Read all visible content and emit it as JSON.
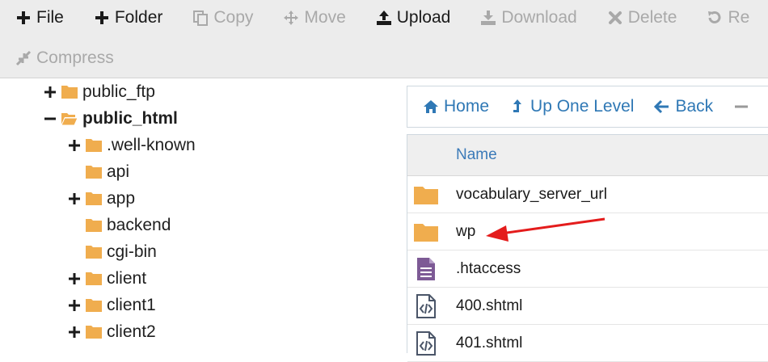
{
  "toolbar": {
    "row1": [
      {
        "label": "File",
        "icon": "plus-icon",
        "enabled": true
      },
      {
        "label": "Folder",
        "icon": "plus-icon",
        "enabled": true
      },
      {
        "label": "Copy",
        "icon": "copy-icon",
        "enabled": false
      },
      {
        "label": "Move",
        "icon": "move-icon",
        "enabled": false
      },
      {
        "label": "Upload",
        "icon": "upload-icon",
        "enabled": true
      },
      {
        "label": "Download",
        "icon": "download-icon",
        "enabled": false
      },
      {
        "label": "Delete",
        "icon": "delete-icon",
        "enabled": false
      },
      {
        "label": "Re",
        "icon": "restore-icon",
        "enabled": false
      }
    ],
    "row2": [
      {
        "label": "Compress",
        "icon": "compress-icon",
        "enabled": false
      }
    ]
  },
  "tree": [
    {
      "label": "public_ftp",
      "toggle": "plus",
      "open": false,
      "bold": false
    },
    {
      "label": "public_html",
      "toggle": "minus",
      "open": true,
      "bold": true
    },
    {
      "label": ".well-known",
      "toggle": "plus",
      "open": false,
      "bold": false
    },
    {
      "label": "api",
      "toggle": "none",
      "open": false,
      "bold": false
    },
    {
      "label": "app",
      "toggle": "plus",
      "open": false,
      "bold": false
    },
    {
      "label": "backend",
      "toggle": "none",
      "open": false,
      "bold": false
    },
    {
      "label": "cgi-bin",
      "toggle": "none",
      "open": false,
      "bold": false
    },
    {
      "label": "client",
      "toggle": "plus",
      "open": false,
      "bold": false
    },
    {
      "label": "client1",
      "toggle": "plus",
      "open": false,
      "bold": false
    },
    {
      "label": "client2",
      "toggle": "plus",
      "open": false,
      "bold": false
    }
  ],
  "nav": {
    "home": "Home",
    "up": "Up One Level",
    "back": "Back"
  },
  "files": {
    "column_name": "Name",
    "rows": [
      {
        "name": "vocabulary_server_url",
        "type": "folder"
      },
      {
        "name": "wp",
        "type": "folder"
      },
      {
        "name": ".htaccess",
        "type": "text-file"
      },
      {
        "name": "400.shtml",
        "type": "code-file"
      },
      {
        "name": "401.shtml",
        "type": "code-file"
      }
    ]
  },
  "colors": {
    "folder": "#f0ad4e",
    "link": "#2f78b5",
    "arrow": "#e41c1c",
    "disabled": "#a9a9a9"
  }
}
